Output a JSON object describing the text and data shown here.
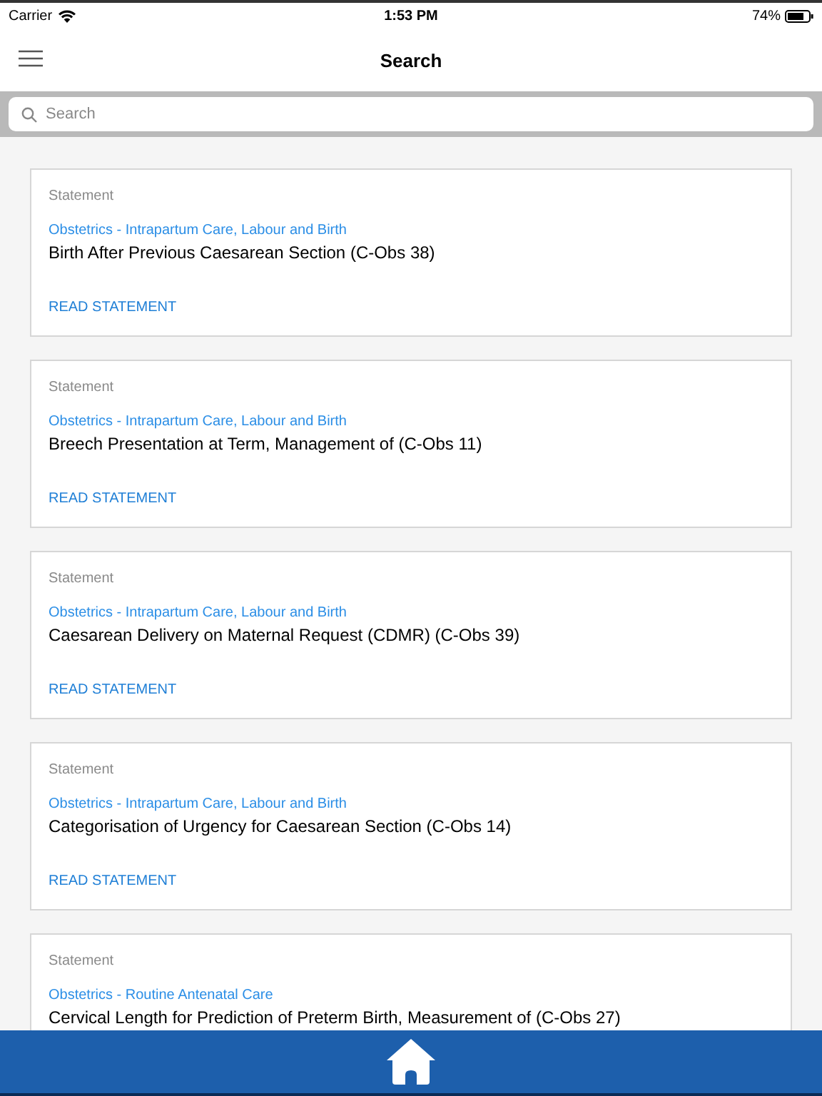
{
  "status_bar": {
    "carrier": "Carrier",
    "time": "1:53 PM",
    "battery": "74%"
  },
  "nav_bar": {
    "title": "Search"
  },
  "search": {
    "placeholder": "Search"
  },
  "results": [
    {
      "type": "Statement",
      "category": "Obstetrics - Intrapartum Care, Labour and Birth",
      "title": "Birth After Previous Caesarean Section (C-Obs 38)",
      "action": "READ STATEMENT"
    },
    {
      "type": "Statement",
      "category": "Obstetrics - Intrapartum Care, Labour and Birth",
      "title": "Breech Presentation at Term, Management of (C-Obs 11)",
      "action": "READ STATEMENT"
    },
    {
      "type": "Statement",
      "category": "Obstetrics - Intrapartum Care, Labour and Birth",
      "title": "Caesarean Delivery on Maternal Request (CDMR) (C-Obs 39)",
      "action": "READ STATEMENT"
    },
    {
      "type": "Statement",
      "category": "Obstetrics - Intrapartum Care, Labour and Birth",
      "title": "Categorisation of Urgency for Caesarean Section (C-Obs 14)",
      "action": "READ STATEMENT"
    },
    {
      "type": "Statement",
      "category": "Obstetrics - Routine Antenatal Care",
      "title": "Cervical Length for Prediction of Preterm Birth, Measurement of (C-Obs 27)"
    }
  ]
}
